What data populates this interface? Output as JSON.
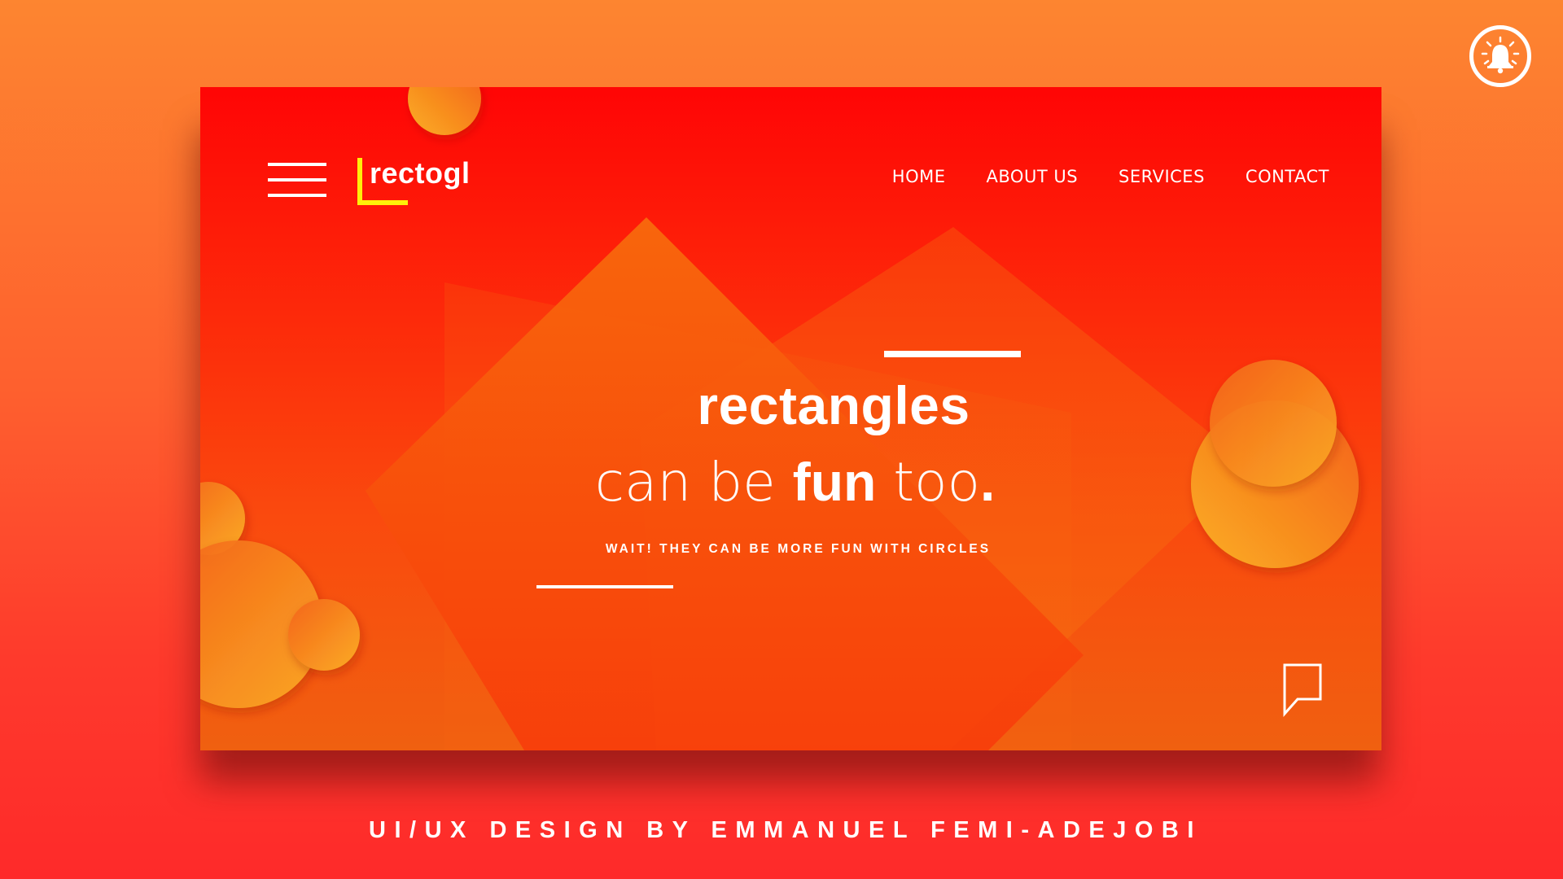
{
  "colors": {
    "page_top": "#fd8530",
    "page_bottom": "#fe2a2a",
    "card_top": "#ff0505",
    "card_bottom": "#f06010",
    "logo_accent": "#ffef0a",
    "circle_light": "#fbad22",
    "circle_dark": "#f3611a",
    "text": "#ffffff"
  },
  "icons": {
    "notification": "bell-icon",
    "menu": "hamburger-icon",
    "chat": "chat-bubble-icon"
  },
  "logo": {
    "text": "rectogl"
  },
  "nav": {
    "items": [
      {
        "label": "HOME"
      },
      {
        "label": "ABOUT US"
      },
      {
        "label": "SERVICES"
      },
      {
        "label": "CONTACT"
      }
    ]
  },
  "hero": {
    "title": "rectangles",
    "subtitle_thin_1": "can be ",
    "subtitle_bold": "fun",
    "subtitle_thin_2": " too",
    "subtitle_period": ".",
    "tagline": "WAIT! THEY CAN BE MORE FUN WITH CIRCLES"
  },
  "credit": "UI/UX DESIGN BY EMMANUEL FEMI-ADEJOBI"
}
